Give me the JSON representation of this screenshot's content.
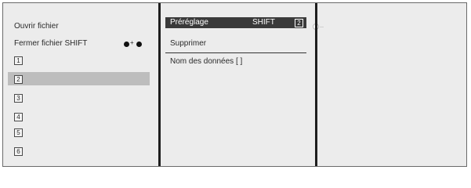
{
  "file_menu": {
    "open_file": "Ouvrir fichier",
    "close_file": "Fermer fichier",
    "close_shortcut": "SHIFT",
    "slots": [
      "1",
      "2",
      "3",
      "4",
      "5",
      "6"
    ],
    "selected_slot": "2"
  },
  "submenu": {
    "preset_label": "Préréglage",
    "preset_shortcut": "SHIFT",
    "preset_number": "2",
    "delete_label": "Supprimer",
    "data_name_label": "Nom des données [ ]"
  }
}
